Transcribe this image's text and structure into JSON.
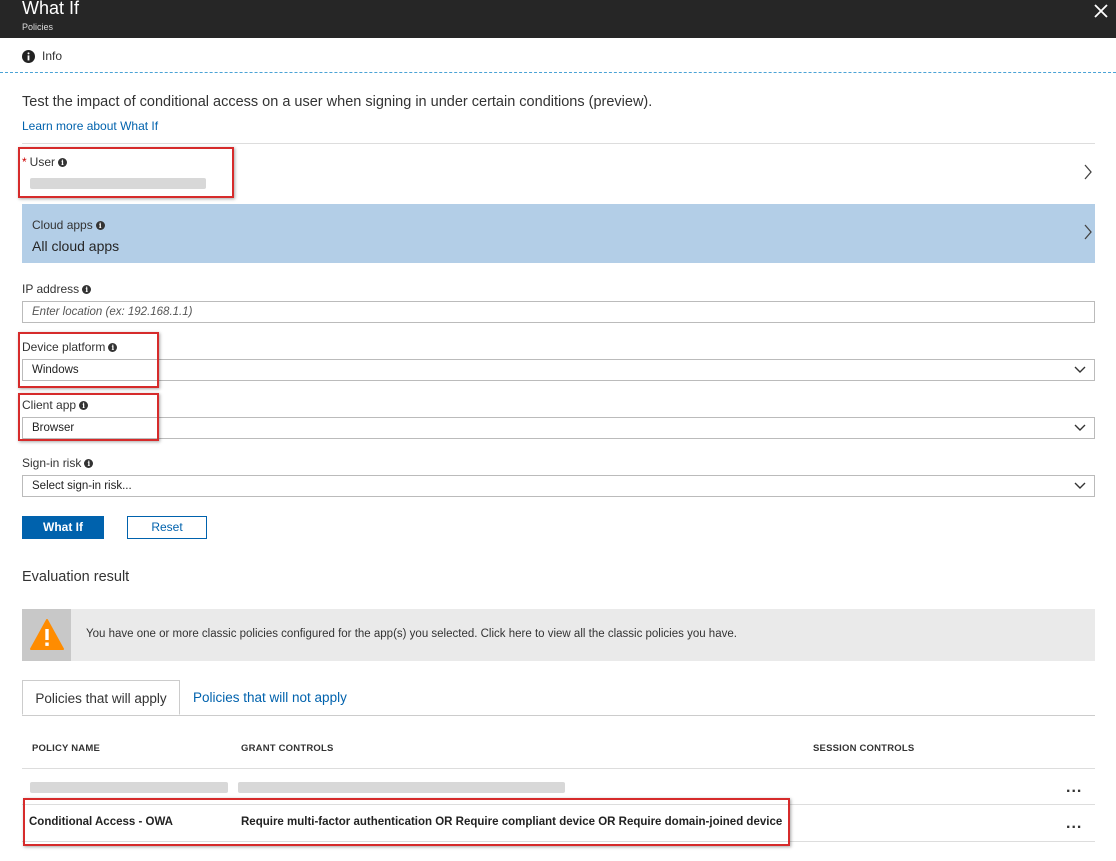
{
  "header": {
    "title": "What If",
    "subtitle": "Policies",
    "close_icon": "close-icon"
  },
  "toolbar": {
    "info_label": "Info",
    "info_icon": "info-icon"
  },
  "intro": {
    "description": "Test the impact of conditional access on a user when signing in under certain conditions (preview).",
    "learn_more": "Learn more about What If"
  },
  "form": {
    "user": {
      "label": "User",
      "required": "*",
      "value": ""
    },
    "cloud_apps": {
      "label": "Cloud apps",
      "value": "All cloud apps"
    },
    "ip_address": {
      "label": "IP address",
      "placeholder": "Enter location (ex: 192.168.1.1)"
    },
    "device_platform": {
      "label": "Device platform",
      "value": "Windows"
    },
    "client_app": {
      "label": "Client app",
      "value": "Browser"
    },
    "sign_in_risk": {
      "label": "Sign-in risk",
      "value": "Select sign-in risk..."
    }
  },
  "actions": {
    "what_if": "What If",
    "reset": "Reset"
  },
  "evaluation": {
    "title": "Evaluation result",
    "warning": "You have one or more classic policies configured for the app(s) you selected. Click here to view all the classic policies you have.",
    "tabs": [
      "Policies that will apply",
      "Policies that will not apply"
    ],
    "columns": [
      "POLICY NAME",
      "GRANT CONTROLS",
      "SESSION CONTROLS"
    ],
    "rows": [
      {
        "name": "",
        "grant": "",
        "session": "",
        "more": "..."
      },
      {
        "name": "Conditional Access - OWA",
        "grant": "Require multi-factor authentication OR Require compliant device OR Require domain-joined device",
        "session": "",
        "more": "..."
      }
    ]
  },
  "colors": {
    "titlebar": "#262626",
    "accent": "#0062ad",
    "selected_row": "#b3cee7",
    "highlight": "#d62b2b",
    "warning": "#ff8c00"
  }
}
